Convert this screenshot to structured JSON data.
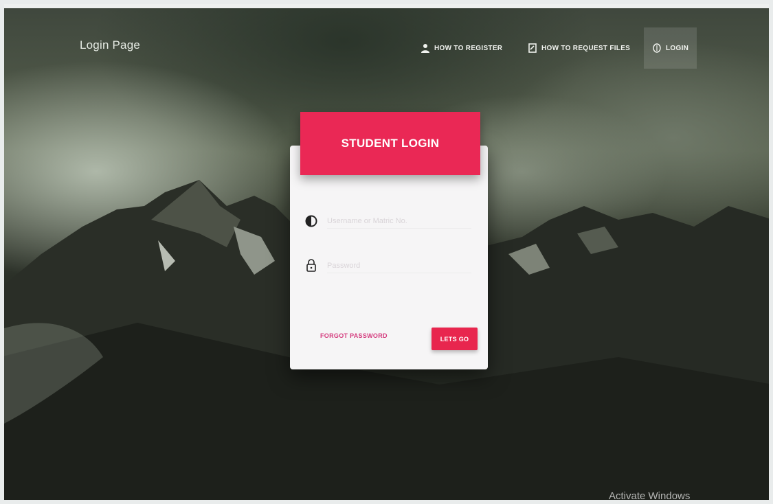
{
  "nav": {
    "brand": "Login Page",
    "links": [
      {
        "label": "HOW TO REGISTER",
        "icon": "user-icon"
      },
      {
        "label": "HOW TO REQUEST FILES",
        "icon": "document-icon"
      },
      {
        "label": "LOGIN",
        "icon": "fingerprint-icon",
        "active": true
      }
    ]
  },
  "login_card": {
    "title": "STUDENT LOGIN",
    "username_placeholder": "Username or Matric No.",
    "password_placeholder": "Password",
    "forgot_label": "FORGOT PASSWORD",
    "submit_label": "LETS GO"
  },
  "watermark": "Activate Windows",
  "colors": {
    "accent": "#ea2855",
    "forgot_link": "#d43c7e",
    "card_bg": "#f6f5f6"
  }
}
